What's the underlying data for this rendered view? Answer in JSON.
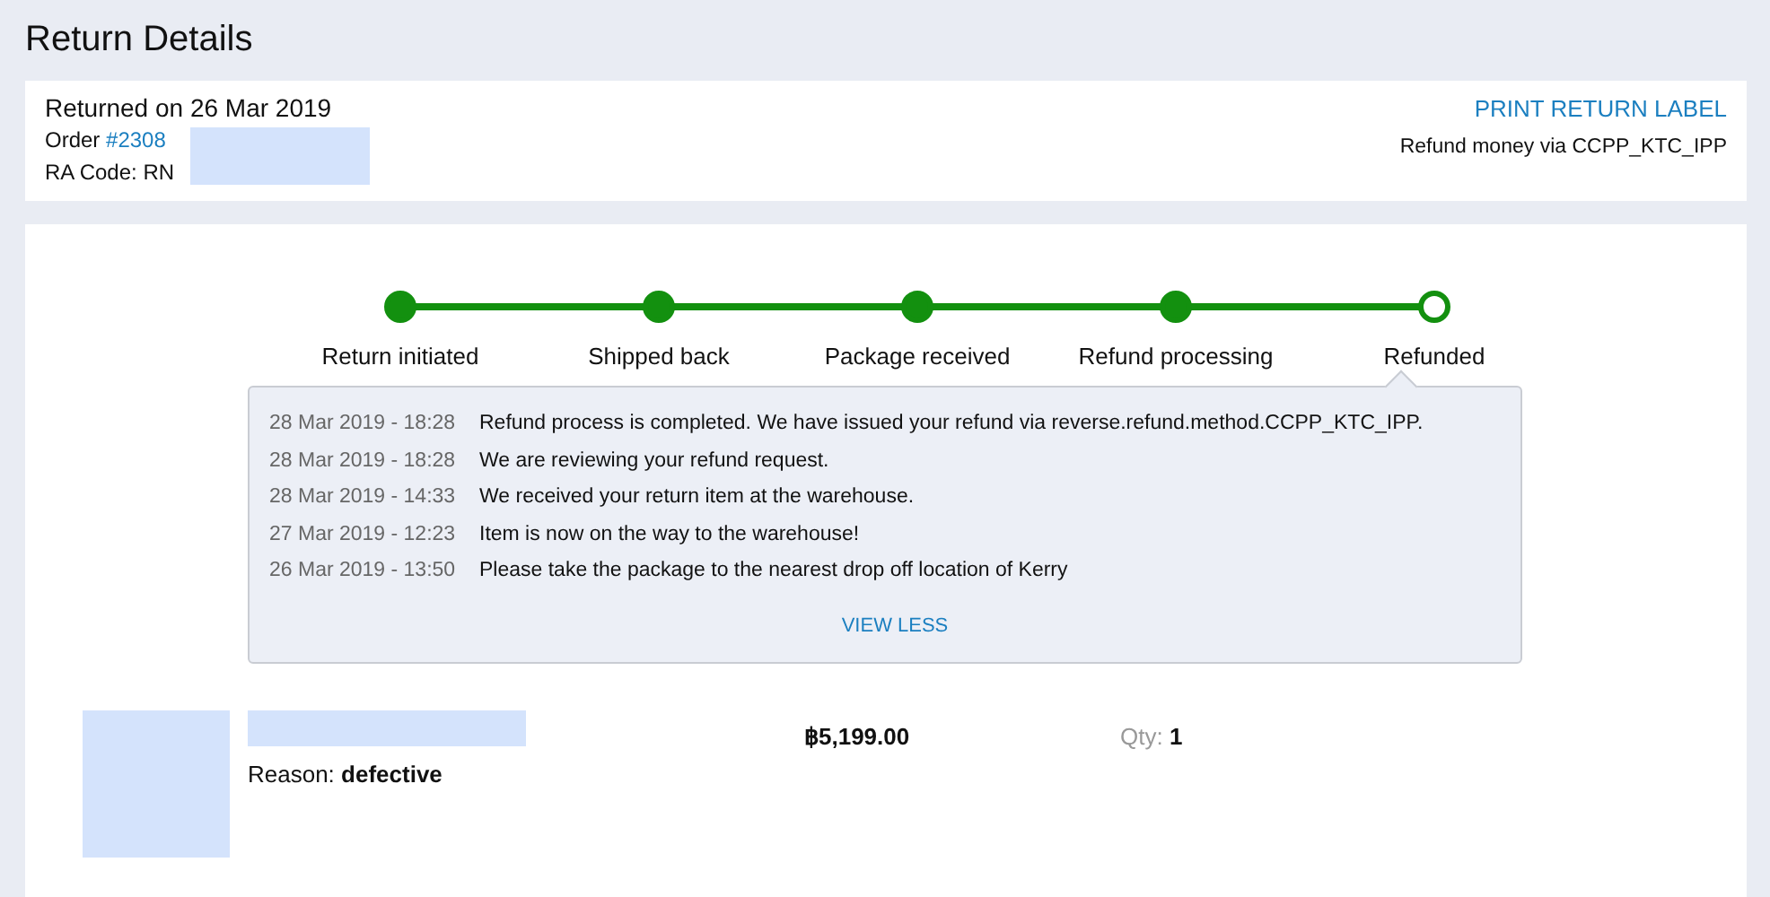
{
  "page_title": "Return Details",
  "summary": {
    "returned_on": "Returned on 26 Mar 2019",
    "order_label": "Order",
    "order_number": "#2308",
    "ra_label": "RA Code: RN",
    "print_link": "PRINT RETURN LABEL",
    "refund_method": "Refund money via CCPP_KTC_IPP"
  },
  "steps": [
    {
      "label": "Return initiated",
      "done": true
    },
    {
      "label": "Shipped back",
      "done": true
    },
    {
      "label": "Package received",
      "done": true
    },
    {
      "label": "Refund processing",
      "done": true
    },
    {
      "label": "Refunded",
      "done": false
    }
  ],
  "history": [
    {
      "time": "28 Mar 2019 - 18:28",
      "message": "Refund process is completed. We have issued your refund via reverse.refund.method.CCPP_KTC_IPP."
    },
    {
      "time": "28 Mar 2019 - 18:28",
      "message": "We are reviewing your refund request."
    },
    {
      "time": "28 Mar 2019 - 14:33",
      "message": "We received your return item at the warehouse."
    },
    {
      "time": "27 Mar 2019 - 12:23",
      "message": "Item is now on the way to the warehouse!"
    },
    {
      "time": "26 Mar 2019 - 13:50",
      "message": "Please take the package to the nearest drop off location of Kerry"
    }
  ],
  "view_less": "VIEW LESS",
  "item": {
    "reason_label": "Reason:",
    "reason": "defective",
    "price": "฿5,199.00",
    "qty_label": "Qty:",
    "qty": "1"
  }
}
